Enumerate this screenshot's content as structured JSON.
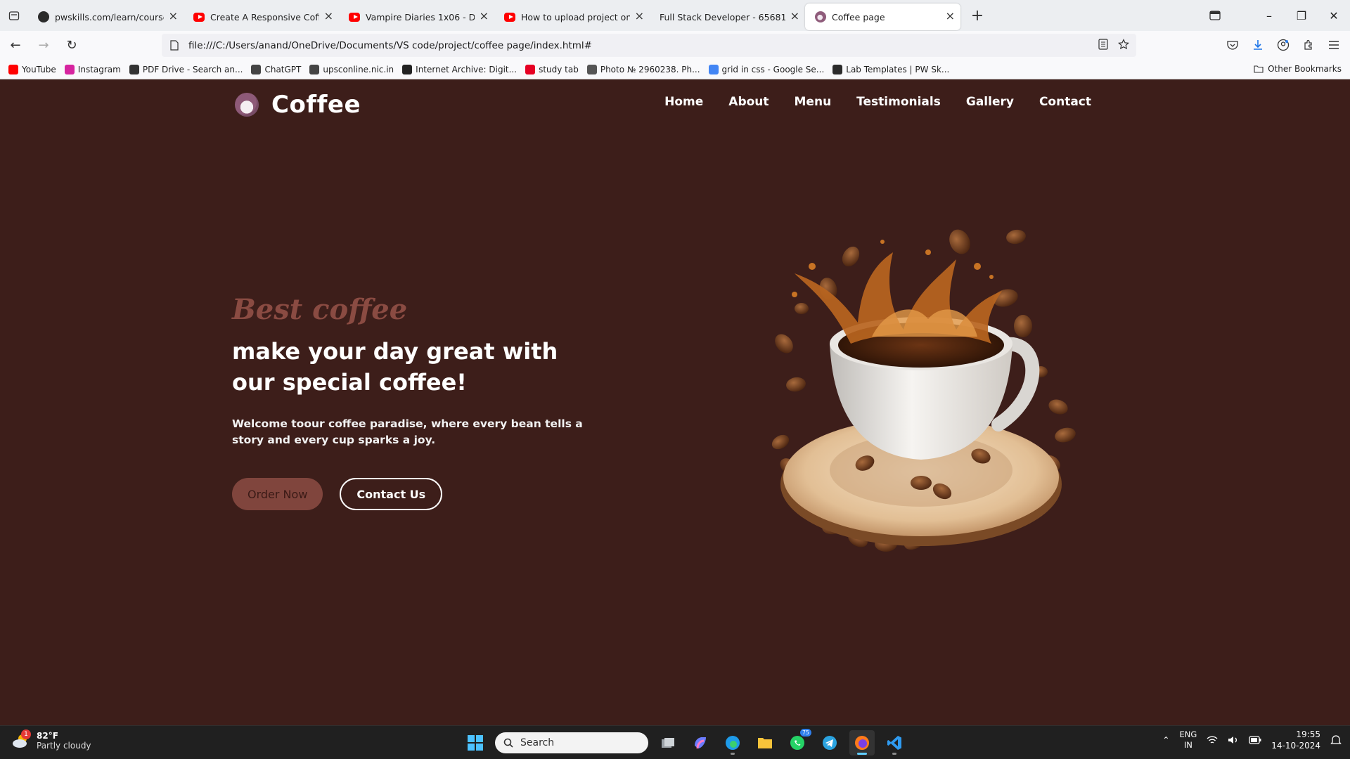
{
  "browser": {
    "tabs": [
      {
        "title": "pwskills.com/learn/course/full-",
        "favicon": "pw-icon",
        "active": false
      },
      {
        "title": "Create A Responsive Coffee",
        "favicon": "youtube-icon",
        "active": false
      },
      {
        "title": "Vampire Diaries 1x06 - Down ( J",
        "favicon": "youtube-icon",
        "active": false
      },
      {
        "title": "How to upload project on githu",
        "favicon": "youtube-icon",
        "active": false
      },
      {
        "title": "Full Stack Developer - 6568179250c2",
        "favicon": "none",
        "active": false
      },
      {
        "title": "Coffee page",
        "favicon": "coffee-icon",
        "active": true
      }
    ],
    "url": "file:///C:/Users/anand/OneDrive/Documents/VS code/project/coffee page/index.html#",
    "bookmarks": [
      {
        "label": "YouTube",
        "icon": "youtube-icon",
        "color": "#ff0000"
      },
      {
        "label": "Instagram",
        "icon": "instagram-icon",
        "color": "#d6249f"
      },
      {
        "label": "PDF Drive - Search an...",
        "icon": "pdf-icon",
        "color": "#333333"
      },
      {
        "label": "ChatGPT",
        "icon": "chatgpt-icon",
        "color": "#444444"
      },
      {
        "label": "upsconline.nic.in",
        "icon": "globe-icon",
        "color": "#444444"
      },
      {
        "label": "Internet Archive: Digit...",
        "icon": "archive-icon",
        "color": "#222222"
      },
      {
        "label": "study tab",
        "icon": "pinterest-icon",
        "color": "#e60023"
      },
      {
        "label": "Photo № 2960238. Ph...",
        "icon": "photo-icon",
        "color": "#555555"
      },
      {
        "label": "grid in css - Google Se...",
        "icon": "google-icon",
        "color": "#4285f4"
      },
      {
        "label": "Lab Templates | PW Sk...",
        "icon": "pw-icon",
        "color": "#2b2b2b"
      }
    ],
    "other_bookmarks": "Other Bookmarks"
  },
  "site": {
    "logo_text": "Coffee",
    "nav": [
      "Home",
      "About",
      "Menu",
      "Testimonials",
      "Gallery",
      "Contact"
    ],
    "hero": {
      "eyebrow": "Best coffee",
      "title": "make your day great with our special coffee!",
      "description": "Welcome toour coffee paradise, where every bean tells a story and every cup sparks a joy.",
      "order_button": "Order Now",
      "contact_button": "Contact Us"
    },
    "colors": {
      "background": "#3d1e1a",
      "accent": "#80453d",
      "eyebrow": "#8a4b42"
    }
  },
  "taskbar": {
    "weather_temp": "82°F",
    "weather_cond": "Partly cloudy",
    "weather_badge": "1",
    "search_placeholder": "Search",
    "whatsapp_count": "75",
    "lang_top": "ENG",
    "lang_bottom": "IN",
    "time": "19:55",
    "date": "14-10-2024"
  }
}
